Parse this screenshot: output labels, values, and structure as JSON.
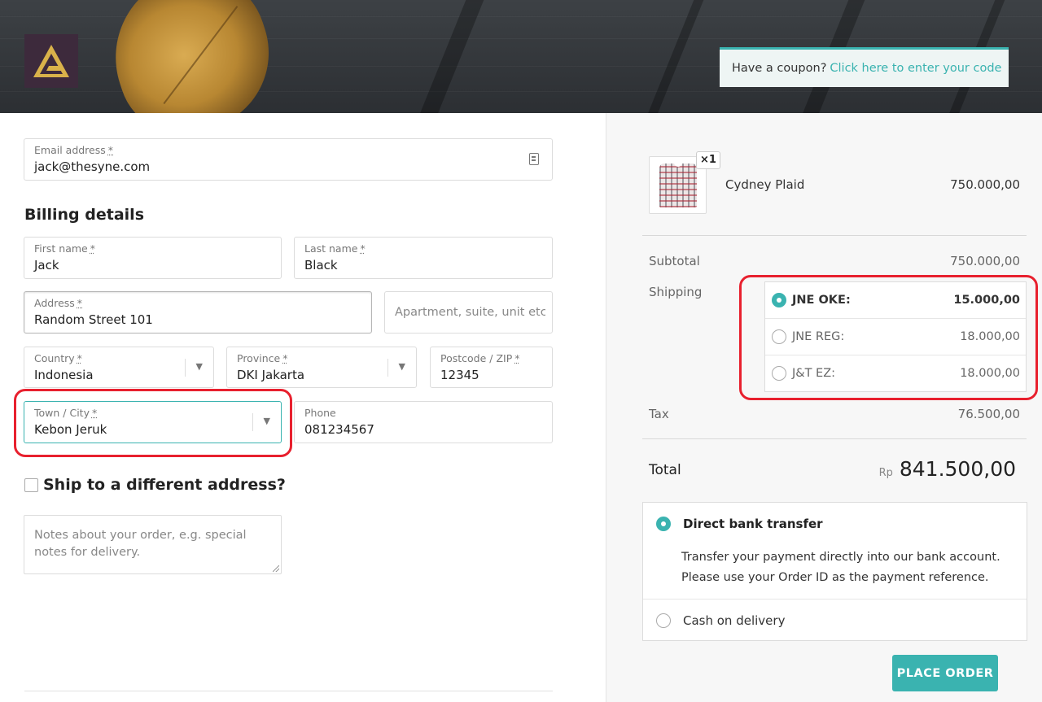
{
  "header": {
    "coupon_prompt": "Have a coupon?",
    "coupon_link": "Click here to enter your code"
  },
  "contact": {
    "email_label": "Email address",
    "email_value": "jack@thesyne.com"
  },
  "billing": {
    "heading": "Billing details",
    "required_mark": "*",
    "first_name_label": "First name",
    "first_name": "Jack",
    "last_name_label": "Last name",
    "last_name": "Black",
    "address_label": "Address",
    "address": "Random Street 101",
    "address2_placeholder": "Apartment, suite, unit etc",
    "country_label": "Country",
    "country": "Indonesia",
    "province_label": "Province",
    "province": "DKI Jakarta",
    "postcode_label": "Postcode / ZIP",
    "postcode": "12345",
    "city_label": "Town / City",
    "city": "Kebon Jeruk",
    "phone_label": "Phone",
    "phone": "081234567"
  },
  "shipping_toggle": {
    "label": "Ship to a different address?",
    "checked": false
  },
  "notes": {
    "placeholder": "Notes about your order, e.g. special notes for delivery."
  },
  "order": {
    "product": {
      "name": "Cydney Plaid",
      "quantity_badge": "×1",
      "price": "750.000,00"
    },
    "subtotal_label": "Subtotal",
    "subtotal": "750.000,00",
    "shipping_label": "Shipping",
    "shipping_options": [
      {
        "name": "JNE OKE:",
        "price": "15.000,00",
        "selected": true
      },
      {
        "name": "JNE REG:",
        "price": "18.000,00",
        "selected": false
      },
      {
        "name": "J&T EZ:",
        "price": "18.000,00",
        "selected": false
      }
    ],
    "tax_label": "Tax",
    "tax": "76.500,00",
    "total_label": "Total",
    "currency": "Rp",
    "total": "841.500,00"
  },
  "payment": {
    "methods": [
      {
        "name": "Direct bank transfer",
        "selected": true
      },
      {
        "name": "Cash on delivery",
        "selected": false
      }
    ],
    "bank_description": "Transfer your payment directly into our bank account. Please use your Order ID as the payment reference.",
    "place_order_label": "PLACE ORDER"
  },
  "colors": {
    "accent": "#3ab3b0",
    "highlight": "#e8202e",
    "logo_bg": "#3d2a3c",
    "logo_mark": "#d9b24a"
  }
}
